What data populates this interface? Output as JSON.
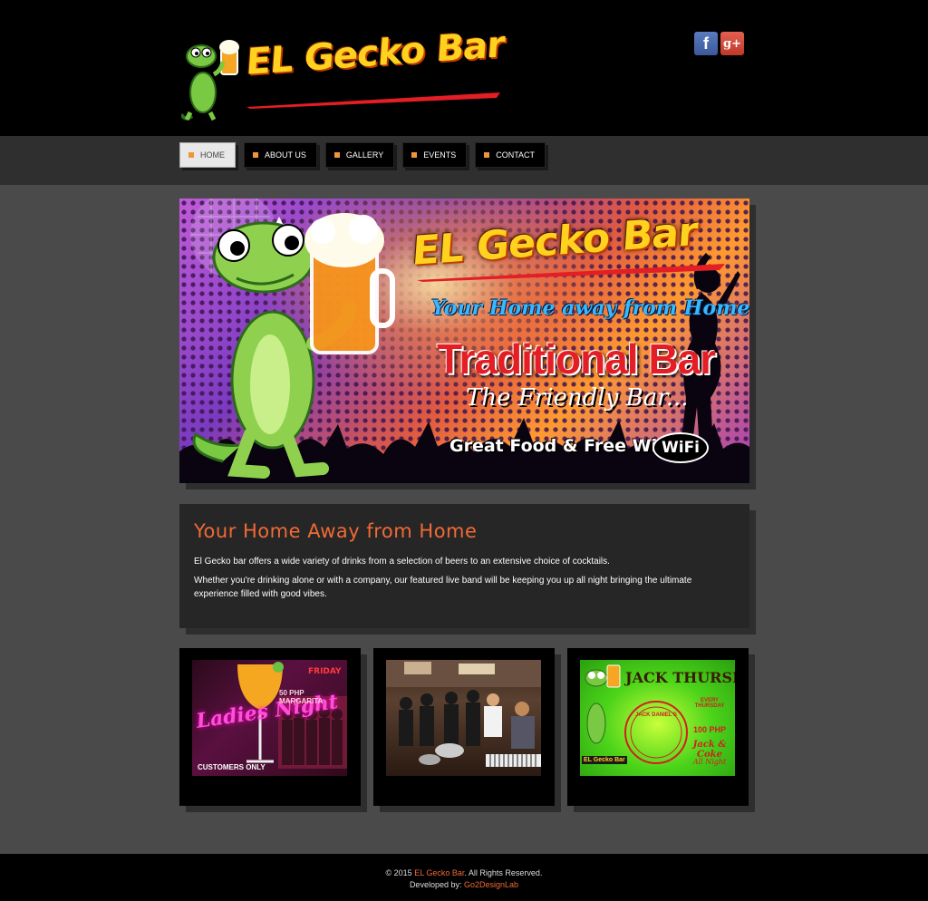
{
  "header": {
    "logo_text": "EL Gecko Bar",
    "social": {
      "facebook_label": "f",
      "google_plus_label": "g+"
    }
  },
  "nav": {
    "items": [
      {
        "label": "HOME",
        "active": true
      },
      {
        "label": "ABOUT US",
        "active": false
      },
      {
        "label": "GALLERY",
        "active": false
      },
      {
        "label": "EVENTS",
        "active": false
      },
      {
        "label": "CONTACT",
        "active": false
      }
    ]
  },
  "banner": {
    "title": "EL Gecko Bar",
    "tagline": "Your Home away from Home",
    "headline": "Traditional Bar",
    "subline": "The Friendly Bar...",
    "features": "Great Food & Free Wi-fi",
    "wifi_badge": "WiFi"
  },
  "content": {
    "title": "Your Home Away from Home",
    "paragraph1": "El Gecko bar offers a wide variety of drinks from a selection of beers to an extensive choice of cocktails.",
    "paragraph2": "Whether you're drinking alone or with a company, our featured live band will be keeping you up all night bringing the ultimate experience filled with good vibes."
  },
  "thumbs": {
    "ladies": {
      "title": "Ladies Night",
      "day": "FRIDAY",
      "offer": "50 PHP MARGARITA",
      "note": "CUSTOMERS ONLY"
    },
    "band": {},
    "jack": {
      "title": "JACK THURSDAYS",
      "when": "EVERY THURSDAY",
      "price": "100 PHP",
      "drink": "Jack & Coke",
      "note": "All Night",
      "brand": "JACK DANIEL'S",
      "logo": "EL Gecko Bar"
    }
  },
  "footer": {
    "copyright_prefix": "© 2015",
    "brand": "EL Gecko Bar",
    "copyright_suffix": ". All Rights Reserved.",
    "dev_prefix": "Developed by:",
    "developer": "Go2DesignLab"
  },
  "colors": {
    "accent": "#f06a35",
    "nav_marker": "#f0963a",
    "facebook": "#3b5998",
    "google_plus": "#c0392b"
  }
}
